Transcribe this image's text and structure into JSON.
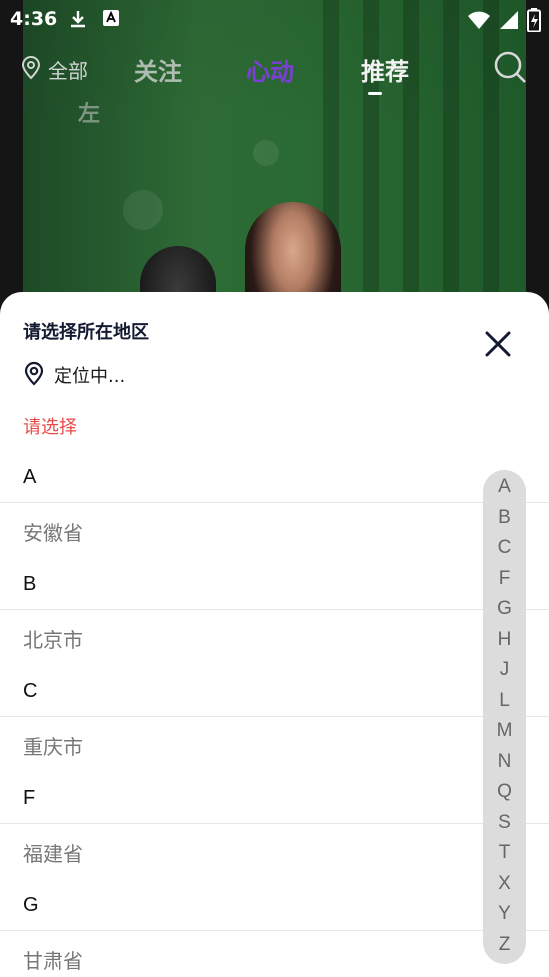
{
  "status_bar": {
    "time": "4:36",
    "left_icons": [
      "download-icon",
      "app-notification-icon"
    ],
    "right_icons": [
      "wifi-icon",
      "signal-icon",
      "battery-charging-icon"
    ]
  },
  "top_nav": {
    "location_label": "全部",
    "tabs": [
      {
        "label": "关注",
        "active": false
      },
      {
        "label": "心动",
        "active": false
      },
      {
        "label": "推荐",
        "active": true
      }
    ],
    "overlay_badge": "左"
  },
  "region_sheet": {
    "title": "请选择所在地区",
    "locating_text": "定位中...",
    "select_hint": "请选择",
    "sections": [
      {
        "letter": "A",
        "items": [
          "安徽省"
        ]
      },
      {
        "letter": "B",
        "items": [
          "北京市"
        ]
      },
      {
        "letter": "C",
        "items": [
          "重庆市"
        ]
      },
      {
        "letter": "F",
        "items": [
          "福建省"
        ]
      },
      {
        "letter": "G",
        "items": [
          "甘肃省"
        ]
      }
    ],
    "index_letters": [
      "A",
      "B",
      "C",
      "F",
      "G",
      "H",
      "J",
      "L",
      "M",
      "N",
      "Q",
      "S",
      "T",
      "X",
      "Y",
      "Z"
    ]
  },
  "colors": {
    "hint_red": "#e94a48",
    "title_navy": "#151a33",
    "index_bar_bg": "#dcdcdc"
  }
}
